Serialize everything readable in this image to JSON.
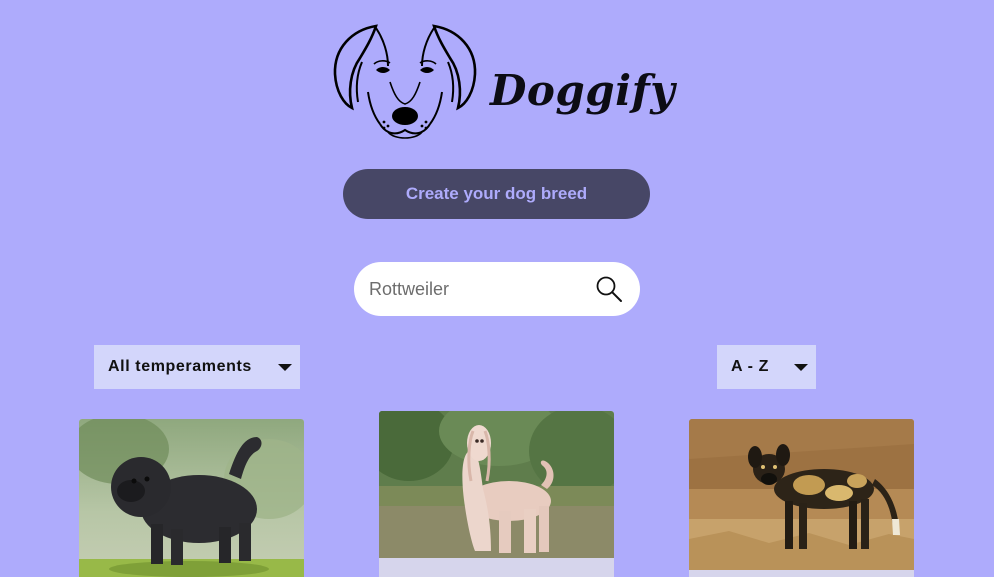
{
  "brand": {
    "name": "Doggify",
    "logo_icon": "dog-face-icon"
  },
  "actions": {
    "create_label": "Create your dog breed"
  },
  "search": {
    "value": "",
    "placeholder": "Rottweiler",
    "icon": "search-icon"
  },
  "filters": {
    "temperament_selected": "All temperaments",
    "order_selected": "A - Z"
  },
  "colors": {
    "background": "#aeabfc",
    "button": "#474766",
    "button_text": "#aeabfc",
    "select_bg": "#d3d6fb"
  },
  "cards": [
    {
      "image": "black-shaggy-dog-photo"
    },
    {
      "image": "afghan-hound-photo"
    },
    {
      "image": "african-wild-dog-photo"
    }
  ]
}
